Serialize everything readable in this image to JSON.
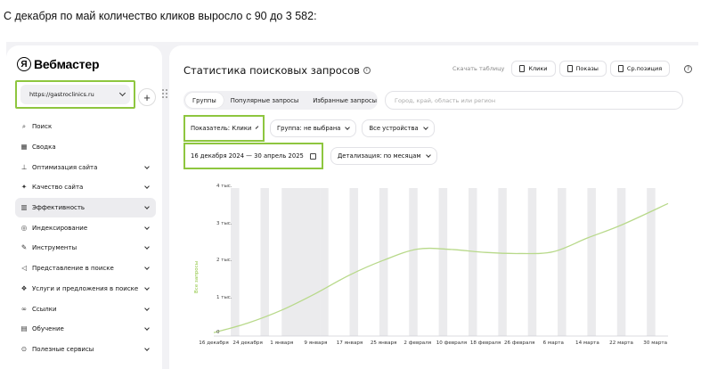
{
  "caption": "С декабря по май количество кликов выросло с 90 до 3 582:",
  "sidebar": {
    "logo_mark": "Я",
    "logo_text": "Вебмастер",
    "site": "https://gastroclinics.ru",
    "add_label": "+",
    "items": [
      {
        "label": "Поиск",
        "icon": "search-icon",
        "glyph": "⌕",
        "chevron": false,
        "active": false
      },
      {
        "label": "Сводка",
        "icon": "grid-icon",
        "glyph": "▦",
        "chevron": false,
        "active": false
      },
      {
        "label": "Оптимизация сайта",
        "icon": "sitemap-icon",
        "glyph": "⊥",
        "chevron": true,
        "active": false
      },
      {
        "label": "Качество сайта",
        "icon": "sparkle-icon",
        "glyph": "✦",
        "chevron": true,
        "active": false
      },
      {
        "label": "Эффективность",
        "icon": "bar-chart-icon",
        "glyph": "▥",
        "chevron": true,
        "active": true
      },
      {
        "label": "Индексирование",
        "icon": "robot-icon",
        "glyph": "◎",
        "chevron": true,
        "active": false
      },
      {
        "label": "Инструменты",
        "icon": "wrench-icon",
        "glyph": "✎",
        "chevron": true,
        "active": false
      },
      {
        "label": "Представление в поиске",
        "icon": "megaphone-icon",
        "glyph": "◁",
        "chevron": true,
        "active": false
      },
      {
        "label": "Услуги и предложения в поиске",
        "icon": "services-icon",
        "glyph": "❖",
        "chevron": true,
        "active": false
      },
      {
        "label": "Ссылки",
        "icon": "link-icon",
        "glyph": "∞",
        "chevron": true,
        "active": false
      },
      {
        "label": "Обучение",
        "icon": "book-icon",
        "glyph": "▤",
        "chevron": true,
        "active": false
      },
      {
        "label": "Полезные сервисы",
        "icon": "compass-icon",
        "glyph": "⊙",
        "chevron": true,
        "active": false
      }
    ]
  },
  "main": {
    "title": "Статистика поисковых запросов",
    "download_table": "Скачать таблицу",
    "metric_buttons": [
      "Клики",
      "Показы",
      "Ср.позиция"
    ],
    "tabs": [
      {
        "label": "Группы",
        "active": true
      },
      {
        "label": "Популярные запросы",
        "active": false
      },
      {
        "label": "Избранные запросы",
        "active": false
      }
    ],
    "search_placeholder": "Город, край, область или регион",
    "filters": {
      "indicator": "Показатель: Клики",
      "group": "Группа: не выбрана",
      "devices": "Все устройства",
      "date_range": "16 декабря 2024 — 30 апрель 2025",
      "detail": "Детализация: по месяцам"
    }
  },
  "chart_data": {
    "type": "line",
    "ylabel": "Все запросы",
    "ylim": [
      0,
      4000
    ],
    "yticks": [
      {
        "v": 0,
        "label": "0"
      },
      {
        "v": 1000,
        "label": "1 тыс."
      },
      {
        "v": 2000,
        "label": "2 тыс."
      },
      {
        "v": 3000,
        "label": "3 тыс."
      },
      {
        "v": 4000,
        "label": "4 тыс."
      }
    ],
    "xlim": [
      0,
      107
    ],
    "xticks": [
      {
        "d": 0,
        "label": "16 декабря"
      },
      {
        "d": 8,
        "label": "24 декабря"
      },
      {
        "d": 16,
        "label": "1 января"
      },
      {
        "d": 24,
        "label": "9 января"
      },
      {
        "d": 32,
        "label": "17 января"
      },
      {
        "d": 40,
        "label": "25 января"
      },
      {
        "d": 48,
        "label": "2 февраля"
      },
      {
        "d": 56,
        "label": "10 февраля"
      },
      {
        "d": 64,
        "label": "18 февраля"
      },
      {
        "d": 72,
        "label": "26 февраля"
      },
      {
        "d": 80,
        "label": "6 марта"
      },
      {
        "d": 88,
        "label": "14 марта"
      },
      {
        "d": 96,
        "label": "22 марта"
      },
      {
        "d": 104,
        "label": "30 марта"
      }
    ],
    "series": [
      {
        "color": "#b8d98a",
        "x": [
          0,
          8,
          16,
          24,
          32,
          40,
          48,
          56,
          64,
          72,
          80,
          88,
          96,
          107
        ],
        "y": [
          90,
          350,
          700,
          1150,
          1650,
          2050,
          2350,
          2340,
          2260,
          2230,
          2280,
          2650,
          3000,
          3582
        ]
      }
    ],
    "weekend_bands": [
      [
        4,
        6
      ],
      [
        11,
        13
      ],
      [
        16,
        25
      ],
      [
        25,
        27
      ],
      [
        32,
        34
      ],
      [
        39,
        41
      ],
      [
        46,
        48
      ],
      [
        53,
        55
      ],
      [
        60,
        62
      ],
      [
        67,
        69
      ],
      [
        74,
        76
      ],
      [
        81,
        83
      ],
      [
        88,
        90
      ],
      [
        95,
        97
      ],
      [
        102,
        104
      ]
    ]
  }
}
